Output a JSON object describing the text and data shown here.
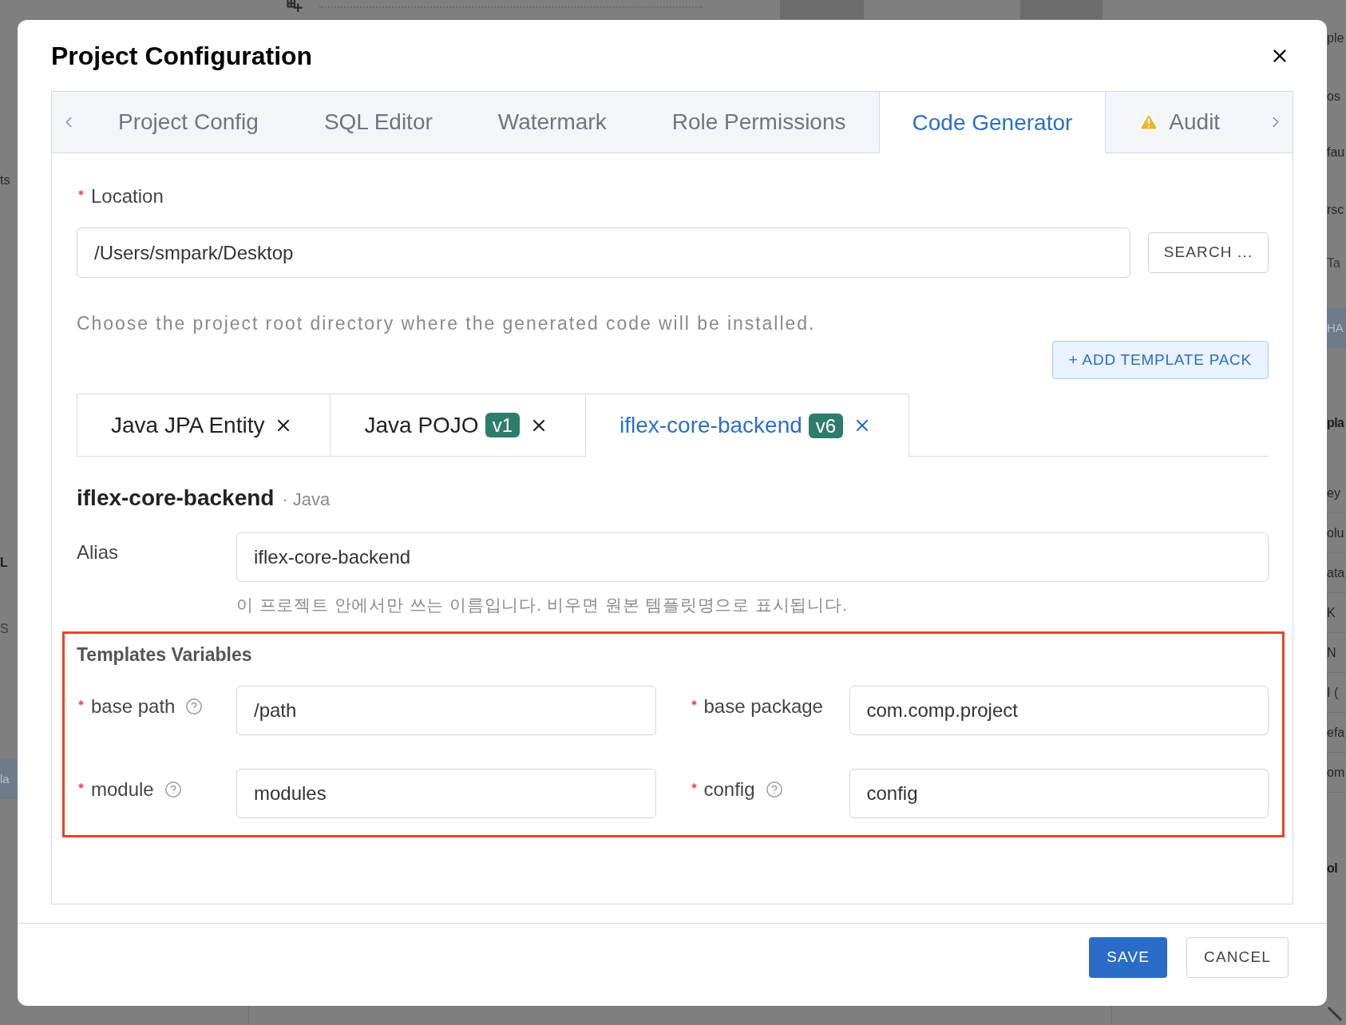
{
  "background": {
    "left_texts": [
      {
        "text": "ts",
        "kind": "text"
      },
      {
        "text": "L",
        "kind": "heading"
      },
      {
        "text": "S",
        "kind": "muted"
      },
      {
        "text": "la",
        "kind": "tag"
      }
    ],
    "right_texts": [
      {
        "text": "ple",
        "kind": "text"
      },
      {
        "text": "os",
        "kind": "text"
      },
      {
        "text": "fau",
        "kind": "text"
      },
      {
        "text": "rsc",
        "kind": "text"
      },
      {
        "text": "Ta",
        "kind": "muted"
      },
      {
        "text": "HA",
        "kind": "tag"
      },
      {
        "text": "pla",
        "kind": "heading"
      },
      {
        "text": "ey",
        "kind": "cell"
      },
      {
        "text": "olu",
        "kind": "cell"
      },
      {
        "text": "ata",
        "kind": "cell"
      },
      {
        "text": "K",
        "kind": "cell"
      },
      {
        "text": "N",
        "kind": "cell"
      },
      {
        "text": "I (",
        "kind": "cell"
      },
      {
        "text": "efa",
        "kind": "cell"
      },
      {
        "text": "om",
        "kind": "cell"
      },
      {
        "text": "ol",
        "kind": "heading"
      }
    ]
  },
  "dialog": {
    "title": "Project Configuration",
    "tabs": [
      {
        "label": "Project Config",
        "selected": false,
        "warning": false
      },
      {
        "label": "SQL Editor",
        "selected": false,
        "warning": false
      },
      {
        "label": "Watermark",
        "selected": false,
        "warning": false
      },
      {
        "label": "Role Permissions",
        "selected": false,
        "warning": false
      },
      {
        "label": "Code Generator",
        "selected": true,
        "warning": false
      },
      {
        "label": "Audit",
        "selected": false,
        "warning": true
      }
    ],
    "location": {
      "label": "Location",
      "required": true,
      "value": "/Users/smpark/Desktop",
      "button": "SEARCH ...",
      "hint": "Choose the project root directory where the generated code will be installed."
    },
    "add_template_button": "+ ADD TEMPLATE PACK",
    "template_tabs": [
      {
        "name": "Java JPA Entity",
        "selected": false
      },
      {
        "name": "Java POJO",
        "badge": "v1",
        "selected": false
      },
      {
        "name": "iflex-core-backend",
        "badge": "v6",
        "selected": true
      }
    ],
    "section": {
      "title": "iflex-core-backend",
      "subtitle": "· Java"
    },
    "alias": {
      "label": "Alias",
      "value": "iflex-core-backend",
      "hint": "이 프로젝트 안에서만 쓰는 이름입니다. 비우면 원본 템플릿명으로 표시됩니다."
    },
    "variables": {
      "title": "Templates Variables",
      "highlighted": true,
      "fields": [
        {
          "label": "base path",
          "required": true,
          "help": true,
          "value": "/path"
        },
        {
          "label": "base package",
          "required": true,
          "help": false,
          "value": "com.comp.project"
        },
        {
          "label": "module",
          "required": true,
          "help": true,
          "value": "modules"
        },
        {
          "label": "config",
          "required": true,
          "help": true,
          "value": "config"
        }
      ]
    },
    "footer_buttons": [
      {
        "label": "SAVE",
        "kind": "primary"
      },
      {
        "label": "CANCEL",
        "kind": "secondary"
      }
    ]
  }
}
